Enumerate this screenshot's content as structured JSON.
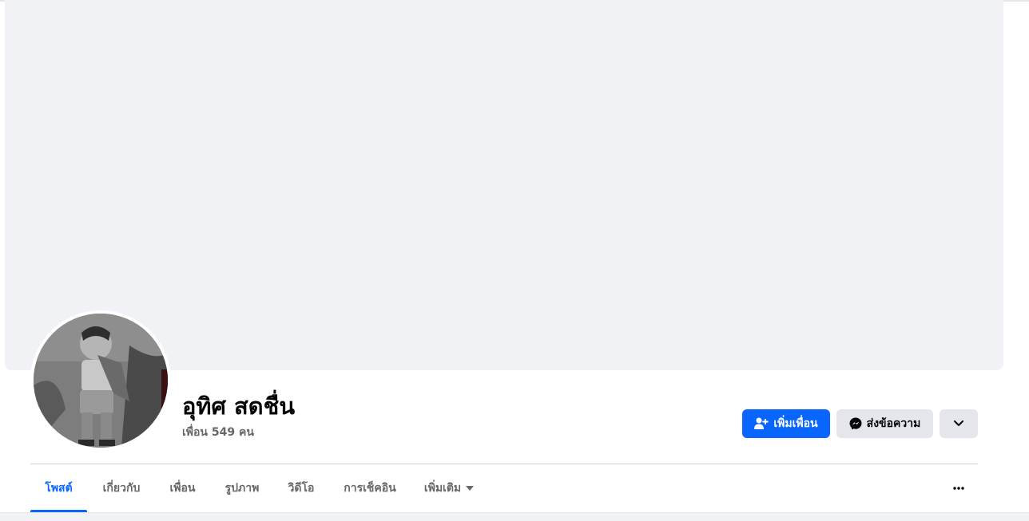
{
  "profile": {
    "name": "อุทิศ สดชื่น",
    "friends_count_text": "เพื่อน 549 คน",
    "avatar_icon": "profile-photo"
  },
  "actions": {
    "add_friend_label": "เพิ่มเพื่อน",
    "add_friend_icon": "person-add-icon",
    "message_label": "ส่งข้อความ",
    "message_icon": "messenger-icon",
    "more_icon": "chevron-down-icon",
    "tabs_more_icon": "more-dots-icon"
  },
  "tabs": [
    {
      "label": "โพสต์",
      "active": true
    },
    {
      "label": "เกี่ยวกับ",
      "active": false
    },
    {
      "label": "เพื่อน",
      "active": false
    },
    {
      "label": "รูปภาพ",
      "active": false
    },
    {
      "label": "วิดีโอ",
      "active": false
    },
    {
      "label": "การเช็คอิน",
      "active": false
    },
    {
      "label": "เพิ่มเติม",
      "active": false
    }
  ],
  "colors": {
    "accent": "#0866ff",
    "secondary_button": "#e4e6eb",
    "cover": "#f0f2f5",
    "muted_text": "#65676b"
  }
}
